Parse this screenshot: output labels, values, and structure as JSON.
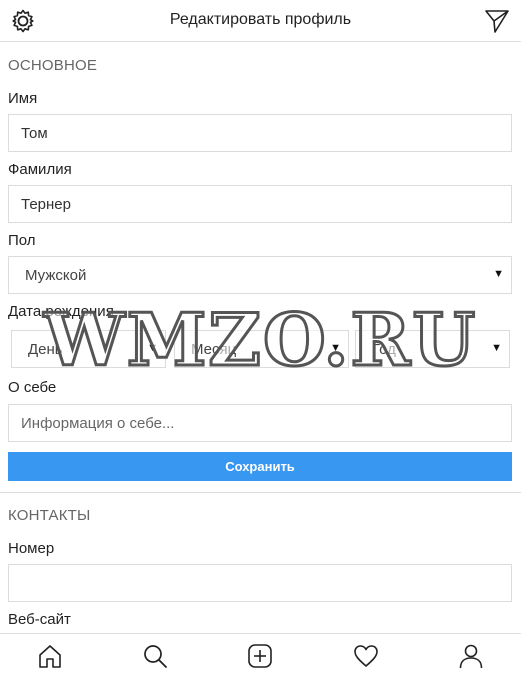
{
  "header": {
    "title": "Редактировать профиль",
    "icons": [
      "settings-gear-icon",
      "send-paper-plane-icon"
    ]
  },
  "basic": {
    "section_title": "ОСНОВНОЕ",
    "first_name": {
      "label": "Имя",
      "value": "Том"
    },
    "last_name": {
      "label": "Фамилия",
      "value": "Тернер"
    },
    "gender": {
      "label": "Пол",
      "selected": "Мужской"
    },
    "birth_date": {
      "label": "Дата рождения",
      "day": "День",
      "month": "Месяц",
      "year": "Год"
    },
    "about": {
      "label": "О себе",
      "placeholder": "Информация о себе..."
    },
    "save_label": "Сохранить"
  },
  "contacts": {
    "section_title": "КОНТАКТЫ",
    "phone": {
      "label": "Номер",
      "value": ""
    },
    "website": {
      "label": "Веб-сайт"
    }
  },
  "watermark": "WMZO.RU",
  "bottom_nav": [
    "home-icon",
    "search-icon",
    "add-post-icon",
    "heart-icon",
    "profile-icon"
  ],
  "colors": {
    "accent": "#3897f0",
    "border": "#dcdcdc",
    "section": "#666666"
  }
}
